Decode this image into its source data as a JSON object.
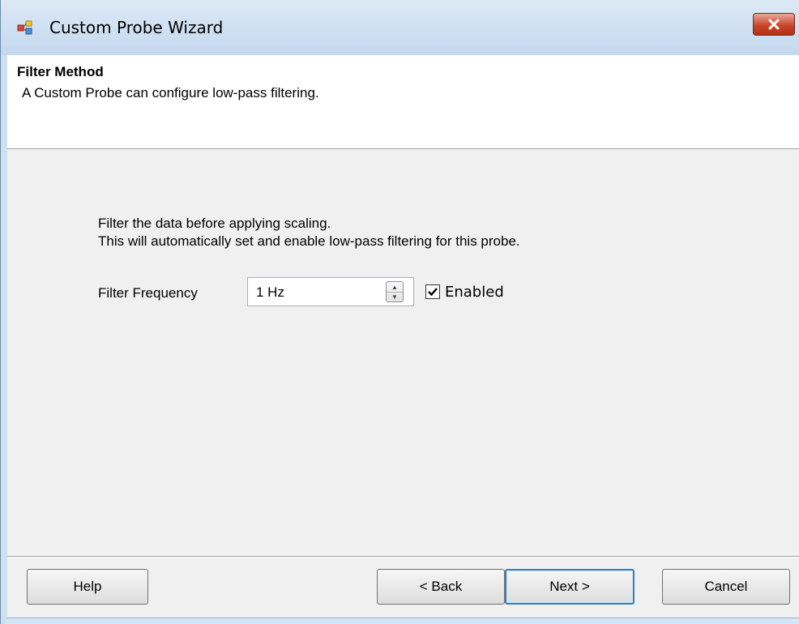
{
  "window": {
    "title": "Custom Probe Wizard",
    "icon": "wizard-app-icon",
    "close_icon": "close-icon"
  },
  "header": {
    "title": "Filter Method",
    "subtitle": "A Custom Probe can configure low-pass filtering."
  },
  "content": {
    "line1": "Filter the data before applying scaling.",
    "line2": "This will automatically set and enable low-pass filtering for this probe.",
    "frequency_label": "Filter Frequency",
    "frequency_value": "1 Hz",
    "enabled_label": "Enabled",
    "enabled_checked": true
  },
  "buttons": {
    "help": "Help",
    "back": "< Back",
    "next": "Next >",
    "cancel": "Cancel"
  },
  "colors": {
    "close_button": "#c9462c",
    "default_button_border": "#3c7fb1",
    "client_background": "#f0f0f0"
  }
}
